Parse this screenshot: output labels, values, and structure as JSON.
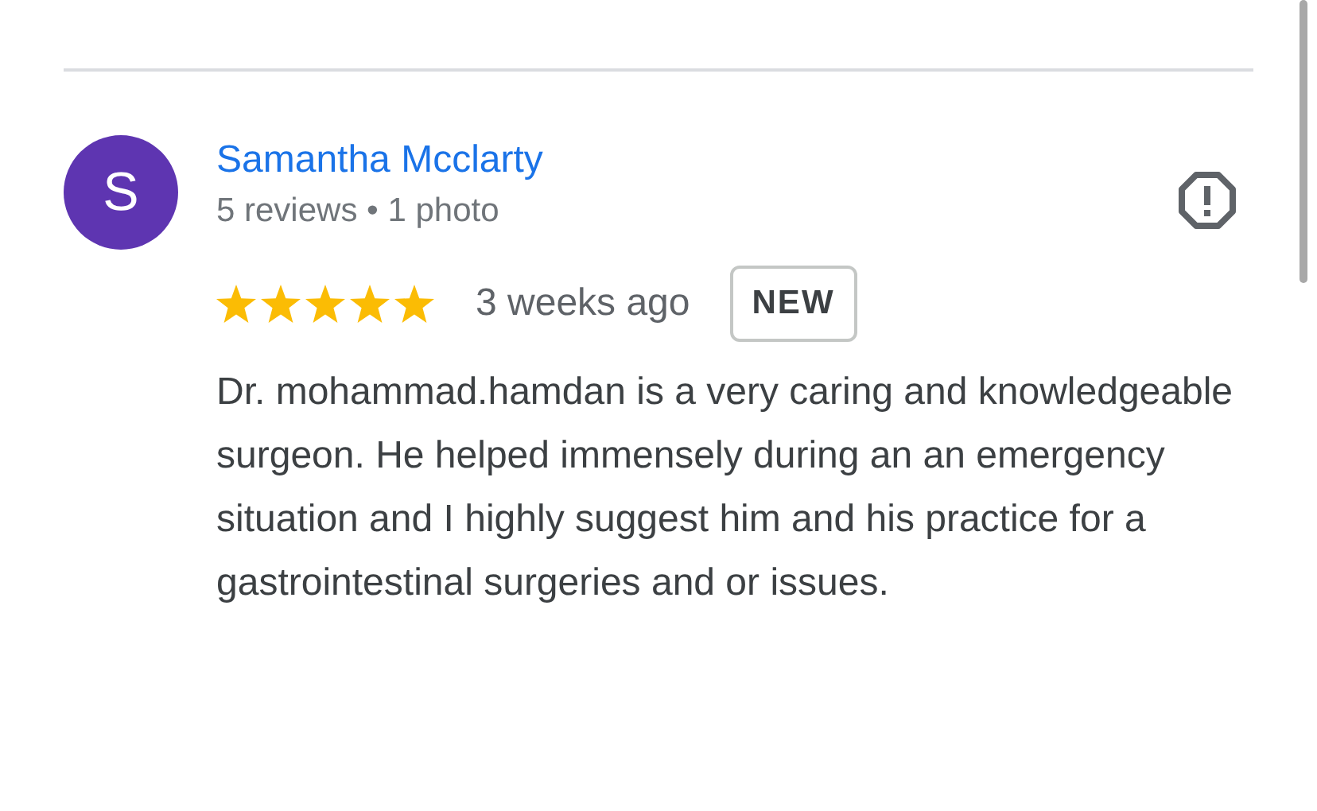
{
  "review": {
    "avatar_letter": "S",
    "author": "Samantha Mcclarty",
    "author_meta": "5 reviews • 1 photo",
    "stars": 5,
    "time": "3 weeks ago",
    "badge": "NEW",
    "text": "Dr. mohammad.hamdan is a very caring and knowledgeable surgeon. He helped immensely during an an emergency situation and I highly suggest him and his practice for a gastrointestinal surgeries and or issues."
  }
}
